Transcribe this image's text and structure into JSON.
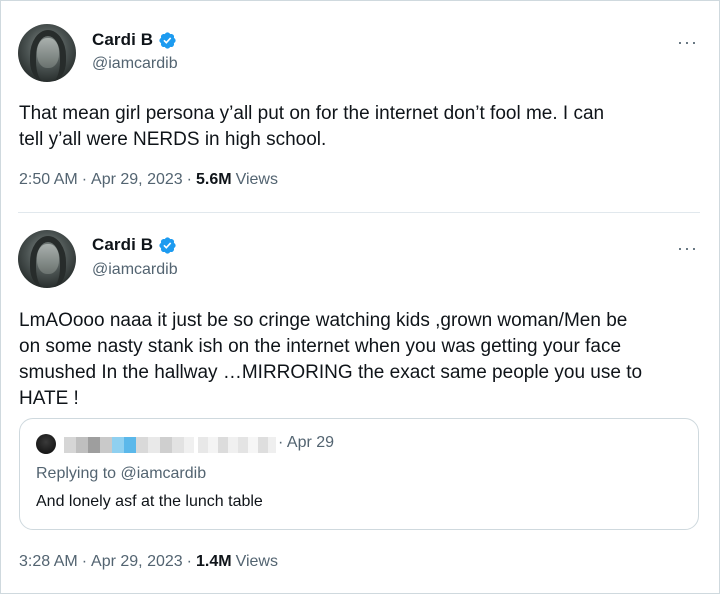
{
  "tweets": [
    {
      "author_name": "Cardi B",
      "handle": "@iamcardib",
      "verified": true,
      "text": "That mean girl persona y’all put on for the internet don’t fool me. I can\ntell y’all were NERDS in high school.",
      "time": "2:50 AM",
      "date": "Apr 29, 2023",
      "views_count": "5.6M",
      "views_label": "Views"
    },
    {
      "author_name": "Cardi B",
      "handle": "@iamcardib",
      "verified": true,
      "text": "LmAOooo naaa it just be so cringe watching kids ,grown woman/Men be\non some nasty stank ish on the internet when you was getting your face\nsmushed In the hallway …MIRRORING the exact same people you use to\nHATE !",
      "time": "3:28 AM",
      "date": "Apr 29, 2023",
      "views_count": "1.4M",
      "views_label": "Views",
      "quoted": {
        "date": "· Apr 29",
        "replying_prefix": "Replying to",
        "replying_handle": "@iamcardib",
        "text": "And lonely asf at the lunch table"
      }
    }
  ],
  "ui": {
    "more_glyph": "···",
    "meta_separator": "·",
    "accent_color": "#1d9bf0",
    "secondary_text_color": "#536471"
  }
}
